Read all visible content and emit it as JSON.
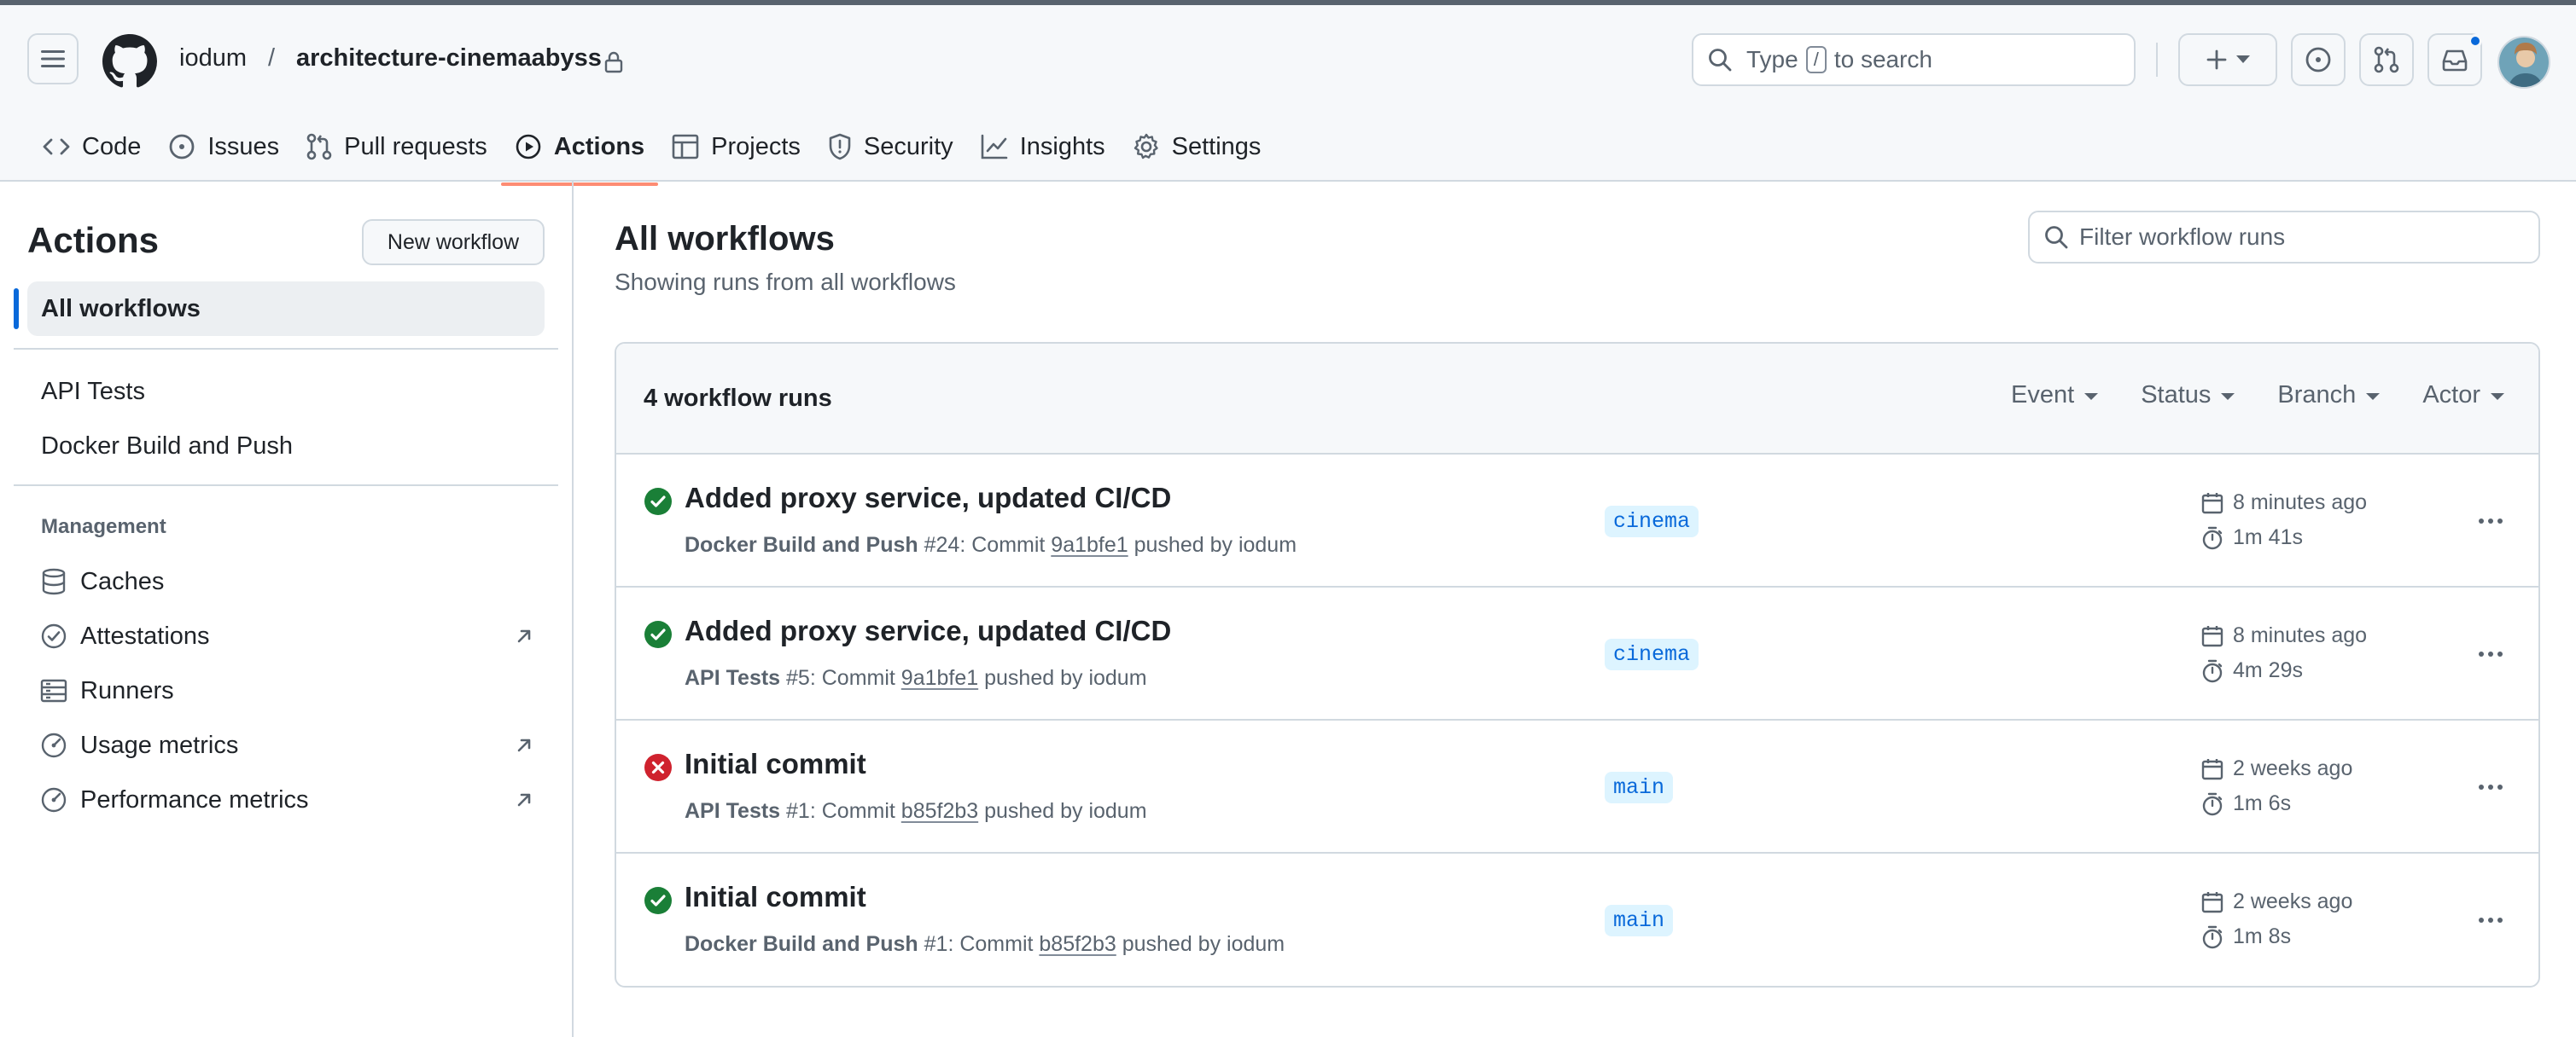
{
  "header": {
    "owner": "iodum",
    "separator": "/",
    "repo": "architecture-cinemaabyss",
    "search": {
      "prefix": "Type",
      "key": "/",
      "suffix": "to search"
    }
  },
  "tabs": [
    {
      "label": "Code",
      "icon": "code-icon"
    },
    {
      "label": "Issues",
      "icon": "issue-opened-icon"
    },
    {
      "label": "Pull requests",
      "icon": "git-pull-request-icon"
    },
    {
      "label": "Actions",
      "icon": "play-icon",
      "active": true
    },
    {
      "label": "Projects",
      "icon": "table-icon"
    },
    {
      "label": "Security",
      "icon": "shield-icon"
    },
    {
      "label": "Insights",
      "icon": "graph-icon"
    },
    {
      "label": "Settings",
      "icon": "gear-icon"
    }
  ],
  "sidebar": {
    "title": "Actions",
    "new_workflow": "New workflow",
    "all_workflows": "All workflows",
    "workflows": [
      "API Tests",
      "Docker Build and Push"
    ],
    "management_heading": "Management",
    "management": [
      {
        "label": "Caches",
        "icon": "database-icon",
        "external": false
      },
      {
        "label": "Attestations",
        "icon": "verified-icon",
        "external": true
      },
      {
        "label": "Runners",
        "icon": "server-icon",
        "external": false
      },
      {
        "label": "Usage metrics",
        "icon": "meter-icon",
        "external": true
      },
      {
        "label": "Performance metrics",
        "icon": "meter-icon",
        "external": true
      }
    ]
  },
  "main": {
    "title": "All workflows",
    "subtitle": "Showing runs from all workflows",
    "filter_placeholder": "Filter workflow runs",
    "runs_count": "4 workflow runs",
    "filters": [
      "Event",
      "Status",
      "Branch",
      "Actor"
    ],
    "runs": [
      {
        "status": "success",
        "title": "Added proxy service, updated CI/CD",
        "workflow": "Docker Build and Push",
        "number": "#24",
        "commit_text": ": Commit",
        "sha": "9a1bfe1",
        "pushed_by": "pushed by iodum",
        "branch": "cinema",
        "when": "8 minutes ago",
        "duration": "1m 41s"
      },
      {
        "status": "success",
        "title": "Added proxy service, updated CI/CD",
        "workflow": "API Tests",
        "number": "#5",
        "commit_text": ": Commit",
        "sha": "9a1bfe1",
        "pushed_by": "pushed by iodum",
        "branch": "cinema",
        "when": "8 minutes ago",
        "duration": "4m 29s"
      },
      {
        "status": "failure",
        "title": "Initial commit",
        "workflow": "API Tests",
        "number": "#1",
        "commit_text": ": Commit",
        "sha": "b85f2b3",
        "pushed_by": "pushed by iodum",
        "branch": "main",
        "when": "2 weeks ago",
        "duration": "1m 6s"
      },
      {
        "status": "success",
        "title": "Initial commit",
        "workflow": "Docker Build and Push",
        "number": "#1",
        "commit_text": ": Commit",
        "sha": "b85f2b3",
        "pushed_by": "pushed by iodum",
        "branch": "main",
        "when": "2 weeks ago",
        "duration": "1m 8s"
      }
    ]
  },
  "colors": {
    "success": "#1a7f37",
    "failure": "#cf222e",
    "accent": "#0969da",
    "tab_underline": "#fd8c73"
  }
}
